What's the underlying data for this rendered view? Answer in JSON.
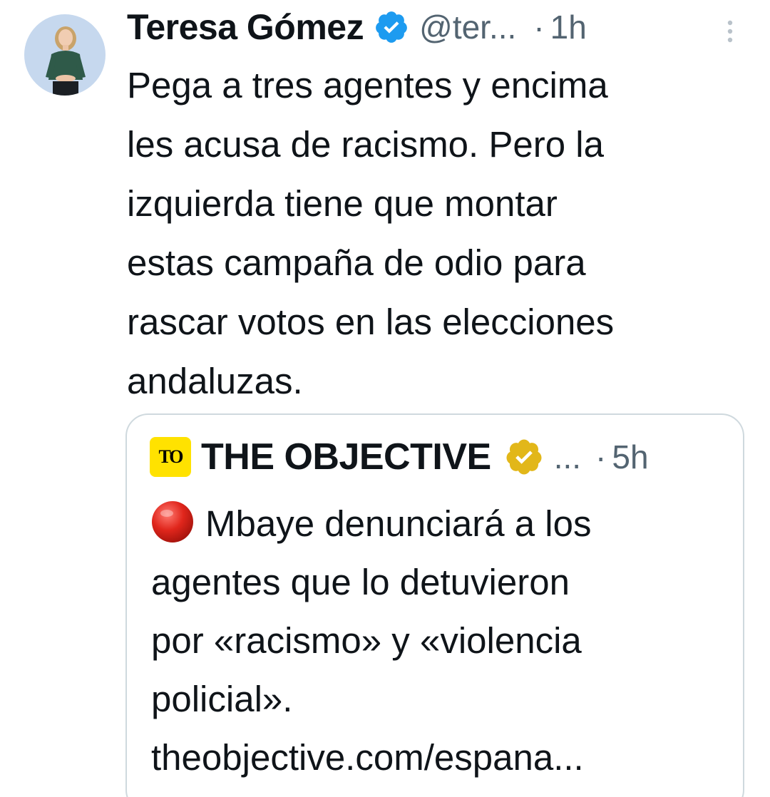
{
  "tweet": {
    "author_name": "Teresa Gómez",
    "handle": "@ter...",
    "separator": "·",
    "time": "1h",
    "text_lines": [
      "Pega a tres agentes y encima",
      "les acusa de racismo. Pero la",
      "izquierda tiene que montar",
      "estas campaña de odio para",
      "rascar votos en las elecciones",
      "andaluzas."
    ],
    "more_icon": "vertical-ellipsis-icon",
    "verified_icon": "verified-badge-icon",
    "verified_color": "#1d9bf0"
  },
  "quote": {
    "logo_text": "TO",
    "logo_color": "#ffe200",
    "author_name": "THE OBJECTIVE",
    "handle": "...",
    "separator": "·",
    "time": "5h",
    "verified_icon": "gold-verified-badge-icon",
    "verified_color": "#e2b719",
    "status_icon": "red-circle-icon",
    "text_lines": [
      "Mbaye denunciará a los",
      "agentes que lo detuvieron",
      "por «racismo» y «violencia",
      "policial».",
      "theobjective.com/espana..."
    ]
  },
  "colors": {
    "text_primary": "#0f1419",
    "text_secondary": "#536471",
    "border": "#cfd9de"
  }
}
